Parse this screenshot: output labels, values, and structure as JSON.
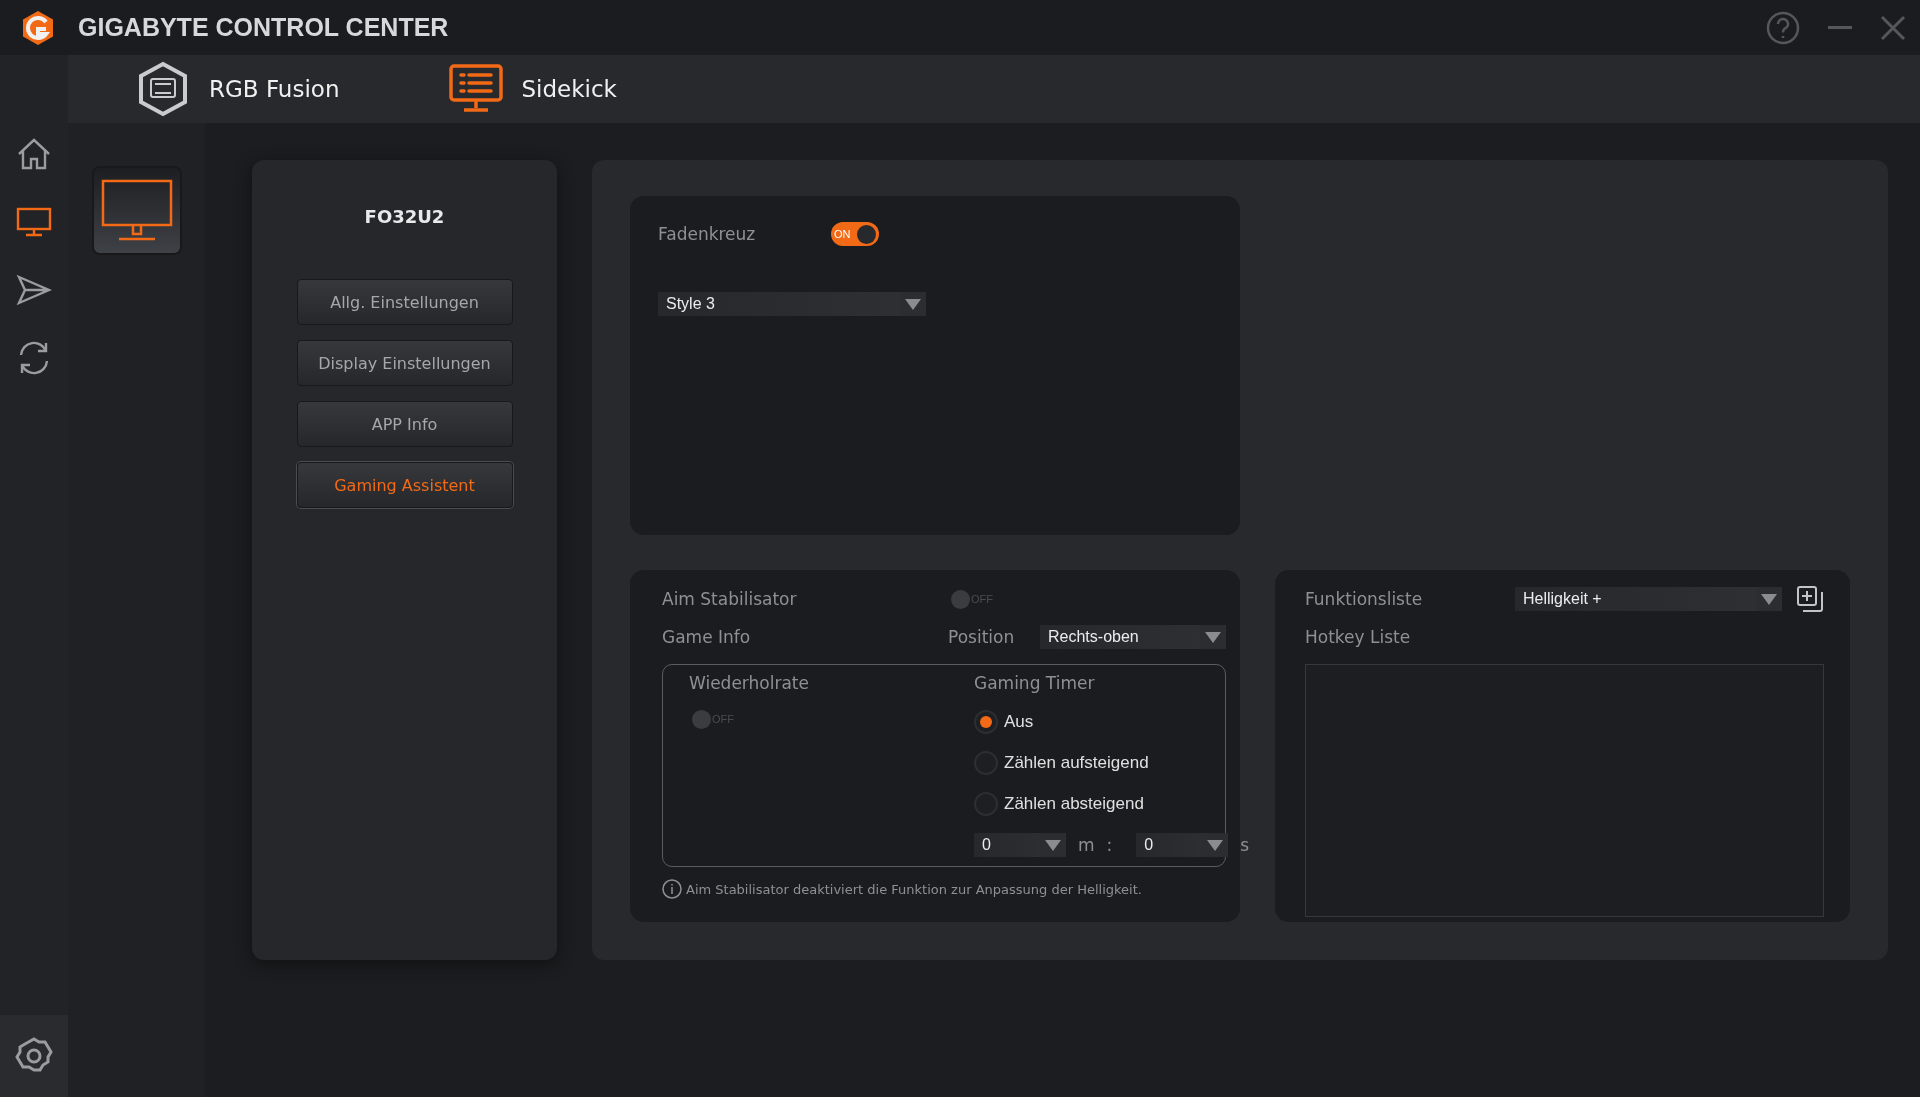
{
  "window": {
    "title": "GIGABYTE CONTROL CENTER"
  },
  "app_tabs": [
    {
      "label": "RGB Fusion",
      "selected": false
    },
    {
      "label": "Sidekick",
      "selected": true
    }
  ],
  "rail": [
    {
      "selected": false
    },
    {
      "selected": true
    },
    {
      "selected": false
    },
    {
      "selected": false
    }
  ],
  "device": {
    "name": "FO32U2"
  },
  "menu": [
    {
      "label": "Allg. Einstellungen",
      "selected": false
    },
    {
      "label": "Display Einstellungen",
      "selected": false
    },
    {
      "label": "APP Info",
      "selected": false
    },
    {
      "label": "Gaming Assistent",
      "selected": true
    }
  ],
  "crosshair": {
    "label": "Fadenkreuz",
    "on": true,
    "toggle_text": "ON",
    "style": "Style 3"
  },
  "game_info": {
    "aim_label": "Aim Stabilisator",
    "aim_on": false,
    "aim_toggle_text": "OFF",
    "label": "Game Info",
    "position_label": "Position",
    "position": "Rechts-oben",
    "refresh_label": "Wiederholrate",
    "refresh_on": false,
    "refresh_toggle_text": "OFF",
    "timer_label": "Gaming Timer",
    "timer_options": [
      {
        "label": "Aus",
        "selected": true
      },
      {
        "label": "Zählen aufsteigend",
        "selected": false
      },
      {
        "label": "Zählen absteigend",
        "selected": false
      }
    ],
    "minutes": "0",
    "minutes_unit": "m",
    "separator": ":",
    "seconds": "0",
    "seconds_unit": "s",
    "note": "Aim Stabilisator deaktiviert die Funktion zur Anpassung der Helligkeit."
  },
  "hotkeys": {
    "function_label": "Funktionsliste",
    "function": "Helligkeit +",
    "list_label": "Hotkey Liste"
  }
}
